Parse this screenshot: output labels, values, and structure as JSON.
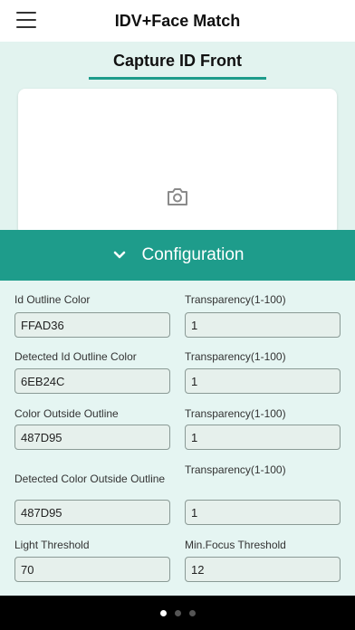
{
  "header": {
    "title": "IDV+Face Match"
  },
  "tab": {
    "label": "Capture ID Front"
  },
  "config": {
    "label": "Configuration"
  },
  "fields": {
    "id_outline_color": {
      "label": "Id Outline Color",
      "value": "FFAD36"
    },
    "transparency_1": {
      "label": "Transparency(1-100)",
      "value": "1"
    },
    "detected_id_outline_color": {
      "label": "Detected Id Outline Color",
      "value": "6EB24C"
    },
    "transparency_2": {
      "label": "Transparency(1-100)",
      "value": "1"
    },
    "color_outside_outline": {
      "label": "Color Outside Outline",
      "value": "487D95"
    },
    "transparency_3": {
      "label": "Transparency(1-100)",
      "value": "1"
    },
    "detected_color_outside_outline": {
      "label": "Detected Color Outside Outline",
      "value": "487D95"
    },
    "transparency_4": {
      "label": "Transparency(1-100)",
      "value": "1"
    },
    "light_threshold": {
      "label": "Light Threshold",
      "value": "70"
    },
    "min_focus_threshold": {
      "label": "Min.Focus Threshold",
      "value": "12"
    }
  },
  "pager": {
    "pages": 3,
    "active": 1
  },
  "colors": {
    "accent": "#1e9c8b",
    "panel_bg": "#e2f3ef"
  },
  "icons": {
    "menu": "hamburger-icon",
    "camera": "camera-icon",
    "chevron": "chevron-down-icon"
  }
}
